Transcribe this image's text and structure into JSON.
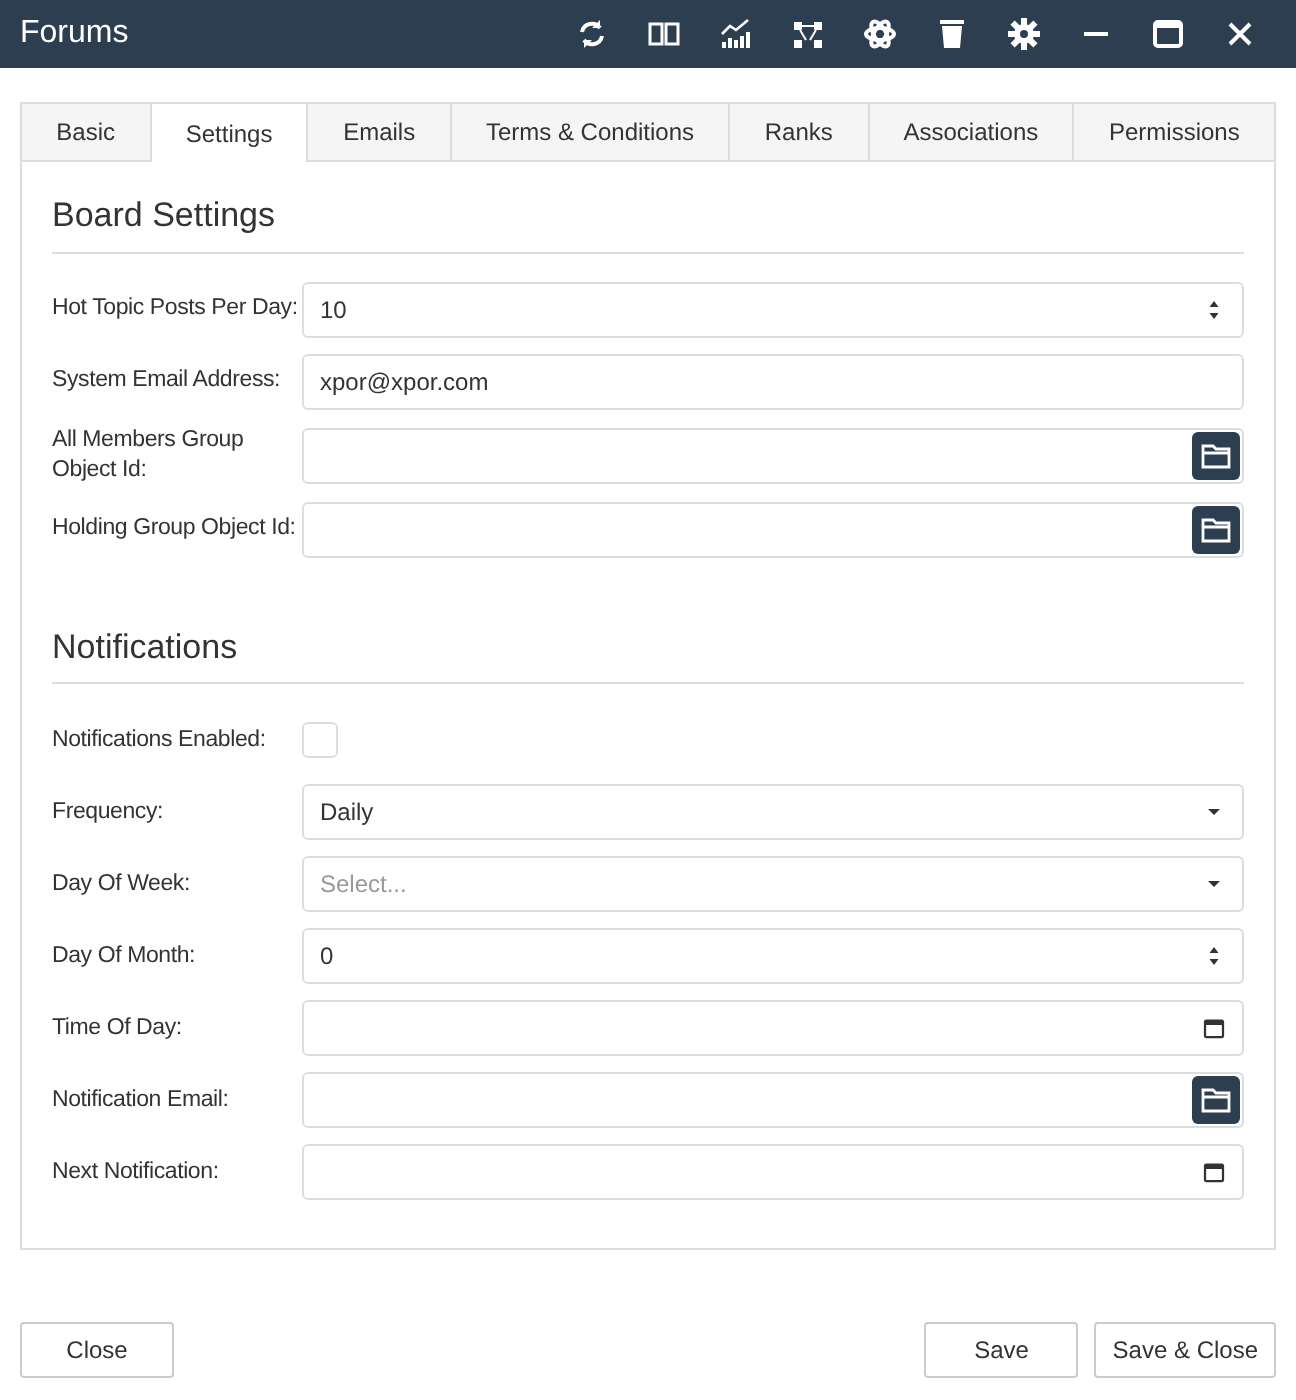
{
  "window": {
    "title": "Forums"
  },
  "tabs": [
    {
      "label": "Basic",
      "selected": false
    },
    {
      "label": "Settings",
      "selected": true
    },
    {
      "label": "Emails",
      "selected": false
    },
    {
      "label": "Terms & Conditions",
      "selected": false
    },
    {
      "label": "Ranks",
      "selected": false
    },
    {
      "label": "Associations",
      "selected": false
    },
    {
      "label": "Permissions",
      "selected": false
    }
  ],
  "sections": [
    {
      "title": "Board Settings",
      "fields": [
        {
          "label": "Hot Topic Posts Per Day:",
          "kind": "number",
          "value": "10"
        },
        {
          "label": "System Email Address:",
          "kind": "text",
          "value": "xpor@xpor.com"
        },
        {
          "label": "All Members Group Object Id:",
          "kind": "lookup"
        },
        {
          "label": "Holding Group Object Id:",
          "kind": "lookup"
        }
      ]
    },
    {
      "title": "Notifications",
      "fields": [
        {
          "label": "Notifications Enabled:",
          "kind": "checkbox",
          "checked": false
        },
        {
          "label": "Frequency:",
          "kind": "select",
          "value": "Daily"
        },
        {
          "label": "Day Of Week:",
          "kind": "select",
          "placeholder": "Select..."
        },
        {
          "label": "Day Of Month:",
          "kind": "number",
          "value": "0"
        },
        {
          "label": "Time Of Day:",
          "kind": "date"
        },
        {
          "label": "Notification Email:",
          "kind": "lookup"
        },
        {
          "label": "Next Notification:",
          "kind": "date"
        }
      ]
    }
  ],
  "footer": {
    "left": [
      "Close"
    ],
    "right": [
      "Save",
      "Save & Close"
    ]
  }
}
